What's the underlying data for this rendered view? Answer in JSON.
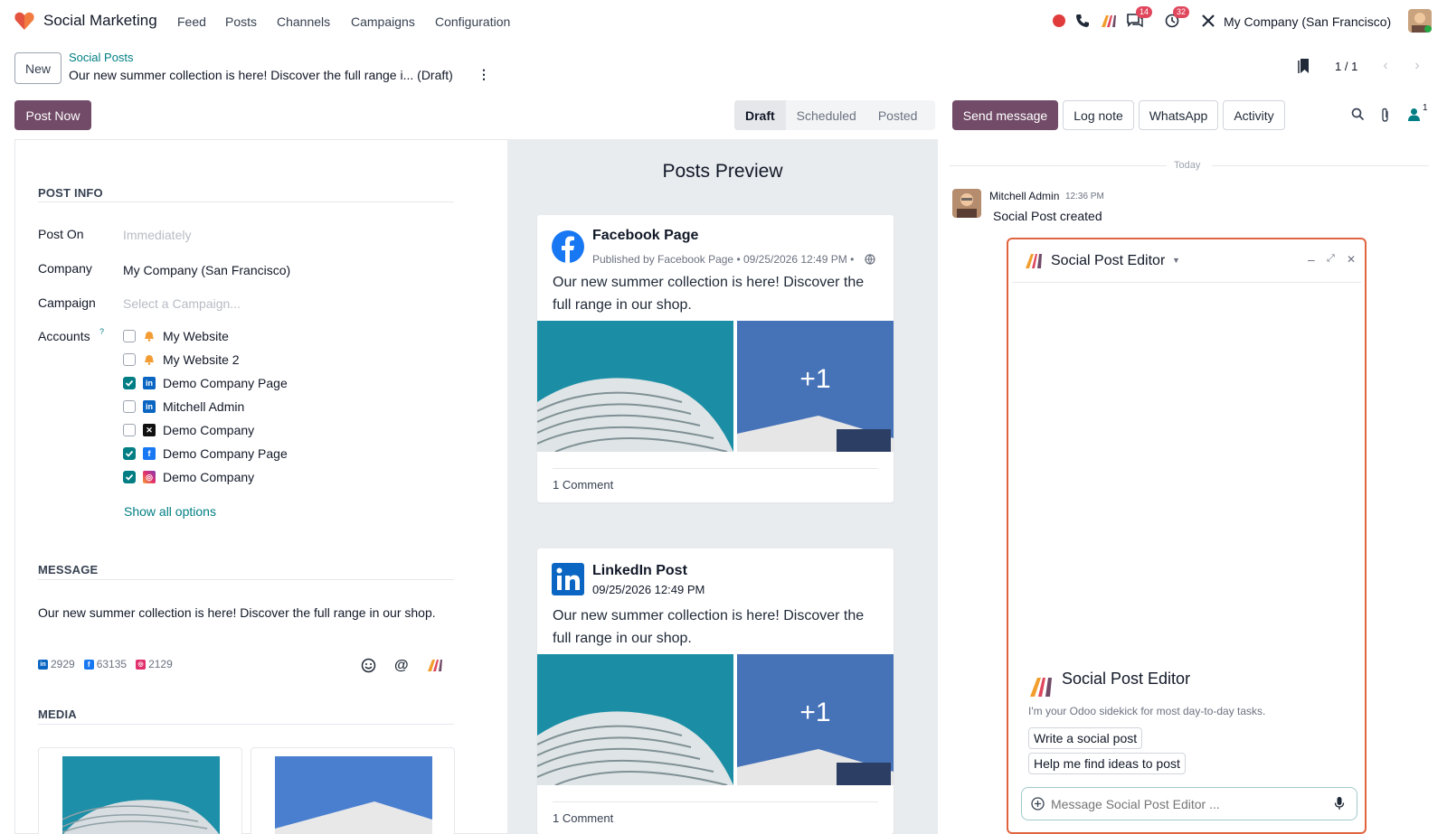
{
  "navbar": {
    "app_name": "Social Marketing",
    "menu": [
      "Feed",
      "Posts",
      "Channels",
      "Campaigns",
      "Configuration"
    ],
    "messages_badge": "14",
    "activities_badge": "32",
    "company": "My Company (San Francisco)"
  },
  "control": {
    "new_label": "New",
    "breadcrumb_parent": "Social Posts",
    "breadcrumb_current": "Our new summer collection is here! Discover the full range i... (Draft)",
    "pager": "1 / 1",
    "post_now": "Post Now",
    "statuses": [
      "Draft",
      "Scheduled",
      "Posted"
    ],
    "active_status": "Draft",
    "send_message": "Send message",
    "log_note": "Log note",
    "whatsapp": "WhatsApp",
    "activity": "Activity",
    "followers_count": "1"
  },
  "form": {
    "post_info_title": "POST INFO",
    "post_on_label": "Post On",
    "post_on_placeholder": "Immediately",
    "company_label": "Company",
    "company_value": "My Company (San Francisco)",
    "campaign_label": "Campaign",
    "campaign_placeholder": "Select a Campaign...",
    "accounts_label": "Accounts",
    "accounts_help": "?",
    "accounts": [
      {
        "name": "My Website",
        "icon": "bell-icon",
        "checked": false
      },
      {
        "name": "My Website 2",
        "icon": "bell-icon",
        "checked": false
      },
      {
        "name": "Demo Company Page",
        "icon": "linkedin-icon",
        "checked": true
      },
      {
        "name": "Mitchell Admin",
        "icon": "linkedin-icon",
        "checked": false
      },
      {
        "name": "Demo Company",
        "icon": "x-icon",
        "checked": false
      },
      {
        "name": "Demo Company Page",
        "icon": "facebook-icon",
        "checked": true
      },
      {
        "name": "Demo Company",
        "icon": "instagram-icon",
        "checked": true
      }
    ],
    "show_all": "Show all options",
    "message_title": "MESSAGE",
    "message_text": "Our new summer collection is here! Discover the full range in our shop.",
    "stats": {
      "linkedin": "2929",
      "facebook": "63135",
      "instagram": "2129"
    },
    "media_title": "MEDIA"
  },
  "preview": {
    "title": "Posts Preview",
    "facebook": {
      "page_name": "Facebook Page",
      "published": "Published by Facebook Page • 09/25/2026 12:49 PM •",
      "text": "Our new summer collection is here! Discover the full range in our shop.",
      "more_images": "+1",
      "comments": "1 Comment"
    },
    "linkedin": {
      "page_name": "LinkedIn Post",
      "date": "09/25/2026 12:49 PM",
      "text": "Our new summer collection is here! Discover the full range in our shop.",
      "more_images": "+1",
      "comments": "1 Comment"
    }
  },
  "chatter": {
    "today": "Today",
    "author": "Mitchell Admin",
    "time": "12:36 PM",
    "message": "Social Post created"
  },
  "ai_panel": {
    "title": "Social Post Editor",
    "intro_title": "Social Post Editor",
    "intro_text": "I'm your Odoo sidekick for most day-to-day tasks.",
    "suggestions": [
      "Write a social post",
      "Help me find ideas to post"
    ],
    "input_placeholder": "Message Social Post Editor ..."
  },
  "colors": {
    "brand": "#714b67",
    "teal": "#017e84",
    "highlight_border": "#e0643f",
    "badge": "#e0475d"
  }
}
